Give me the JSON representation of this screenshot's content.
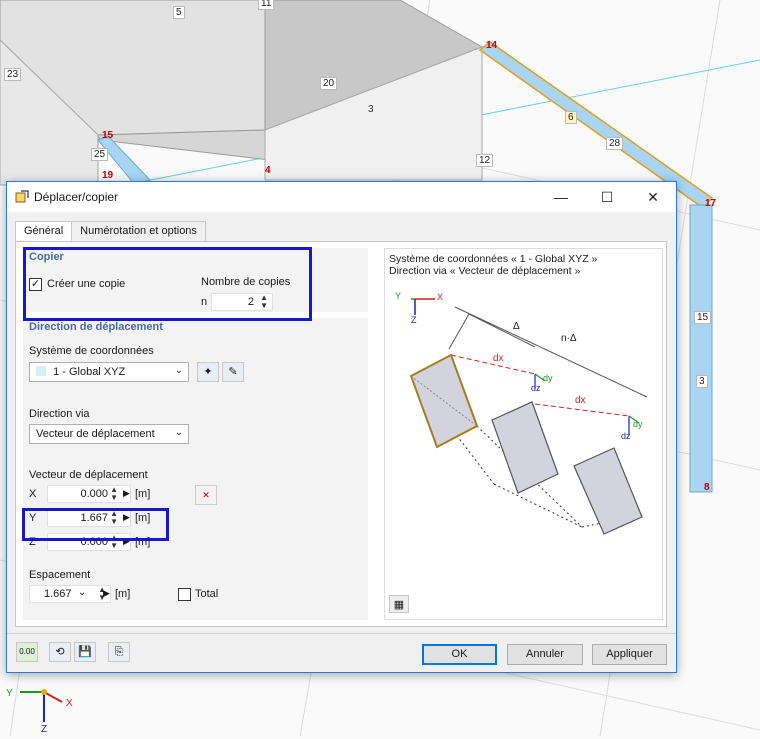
{
  "viewport": {
    "member_labels": [
      "5",
      "11",
      "23",
      "20",
      "3",
      "12",
      "6",
      "28",
      "15",
      "3"
    ],
    "node_labels": [
      "14",
      "15",
      "25",
      "19",
      "4",
      "17",
      "8"
    ],
    "axes": {
      "x": "X",
      "y": "Y",
      "z": "Z"
    }
  },
  "dialog": {
    "title": "Déplacer/copier",
    "window_buttons": {
      "minimize": "—",
      "maximize": "☐",
      "close": "✕"
    },
    "tabs": [
      "Général",
      "Numérotation et options"
    ],
    "copy_group": {
      "title": "Copier",
      "create_copy_label": "Créer une copie",
      "create_copy_checked": true,
      "copies_label": "Nombre de copies",
      "n_label": "n",
      "n_value": "2"
    },
    "direction_group": {
      "title": "Direction de déplacement",
      "coord_system_label": "Système de coordonnées",
      "coord_system_value": "1 - Global XYZ",
      "direction_via_label": "Direction via",
      "direction_via_value": "Vecteur de déplacement",
      "vector_label": "Vecteur de déplacement",
      "x_label": "X",
      "x_value": "0.000",
      "y_label": "Y",
      "y_value": "1.667",
      "z_label": "Z",
      "z_value": "0.000",
      "unit": "[m]",
      "spacing_label": "Espacement",
      "spacing_value": "1.667",
      "spacing_unit": "[m]",
      "total_label": "Total",
      "total_checked": false
    },
    "preview": {
      "line1": "Système de coordonnées « 1 - Global XYZ »",
      "line2": "Direction via « Vecteur de déplacement »",
      "delta": "Δ",
      "n_delta": "n·Δ",
      "dx": "dx",
      "dy": "dy",
      "dz": "dz"
    },
    "footer": {
      "units_icon": "0.00",
      "ok": "OK",
      "cancel": "Annuler",
      "apply": "Appliquer"
    }
  },
  "colors": {
    "highlight": "#1818c8",
    "accent": "#2b79d8",
    "member_blue": "#a9d5f2",
    "node_red": "#c00000"
  }
}
